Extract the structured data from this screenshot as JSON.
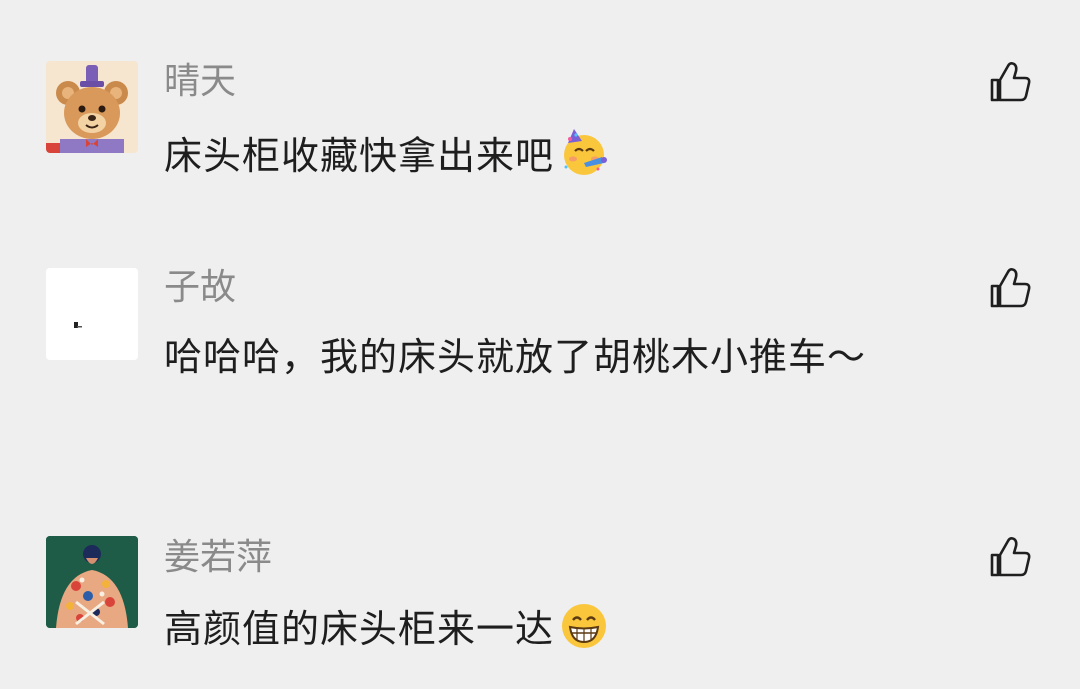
{
  "comments": [
    {
      "author": "晴天",
      "text": "床头柜收藏快拿出来吧",
      "emoji": "partying-face-emoji",
      "avatar": "cartoon-bear-avatar"
    },
    {
      "author": "子故",
      "text": "哈哈哈，我的床头就放了胡桃木小推车～",
      "avatar": "white-minimal-avatar"
    },
    {
      "author": "姜若萍",
      "text": "高颜值的床头柜来一达",
      "emoji": "grinning-face-emoji",
      "avatar": "illustrated-woman-avatar"
    }
  ],
  "icons": {
    "like": "thumbs-up-icon"
  },
  "colors": {
    "background": "#efeff0",
    "author": "#8a8a8a",
    "text": "#1e1e1e",
    "icon": "#1f1f1f"
  }
}
